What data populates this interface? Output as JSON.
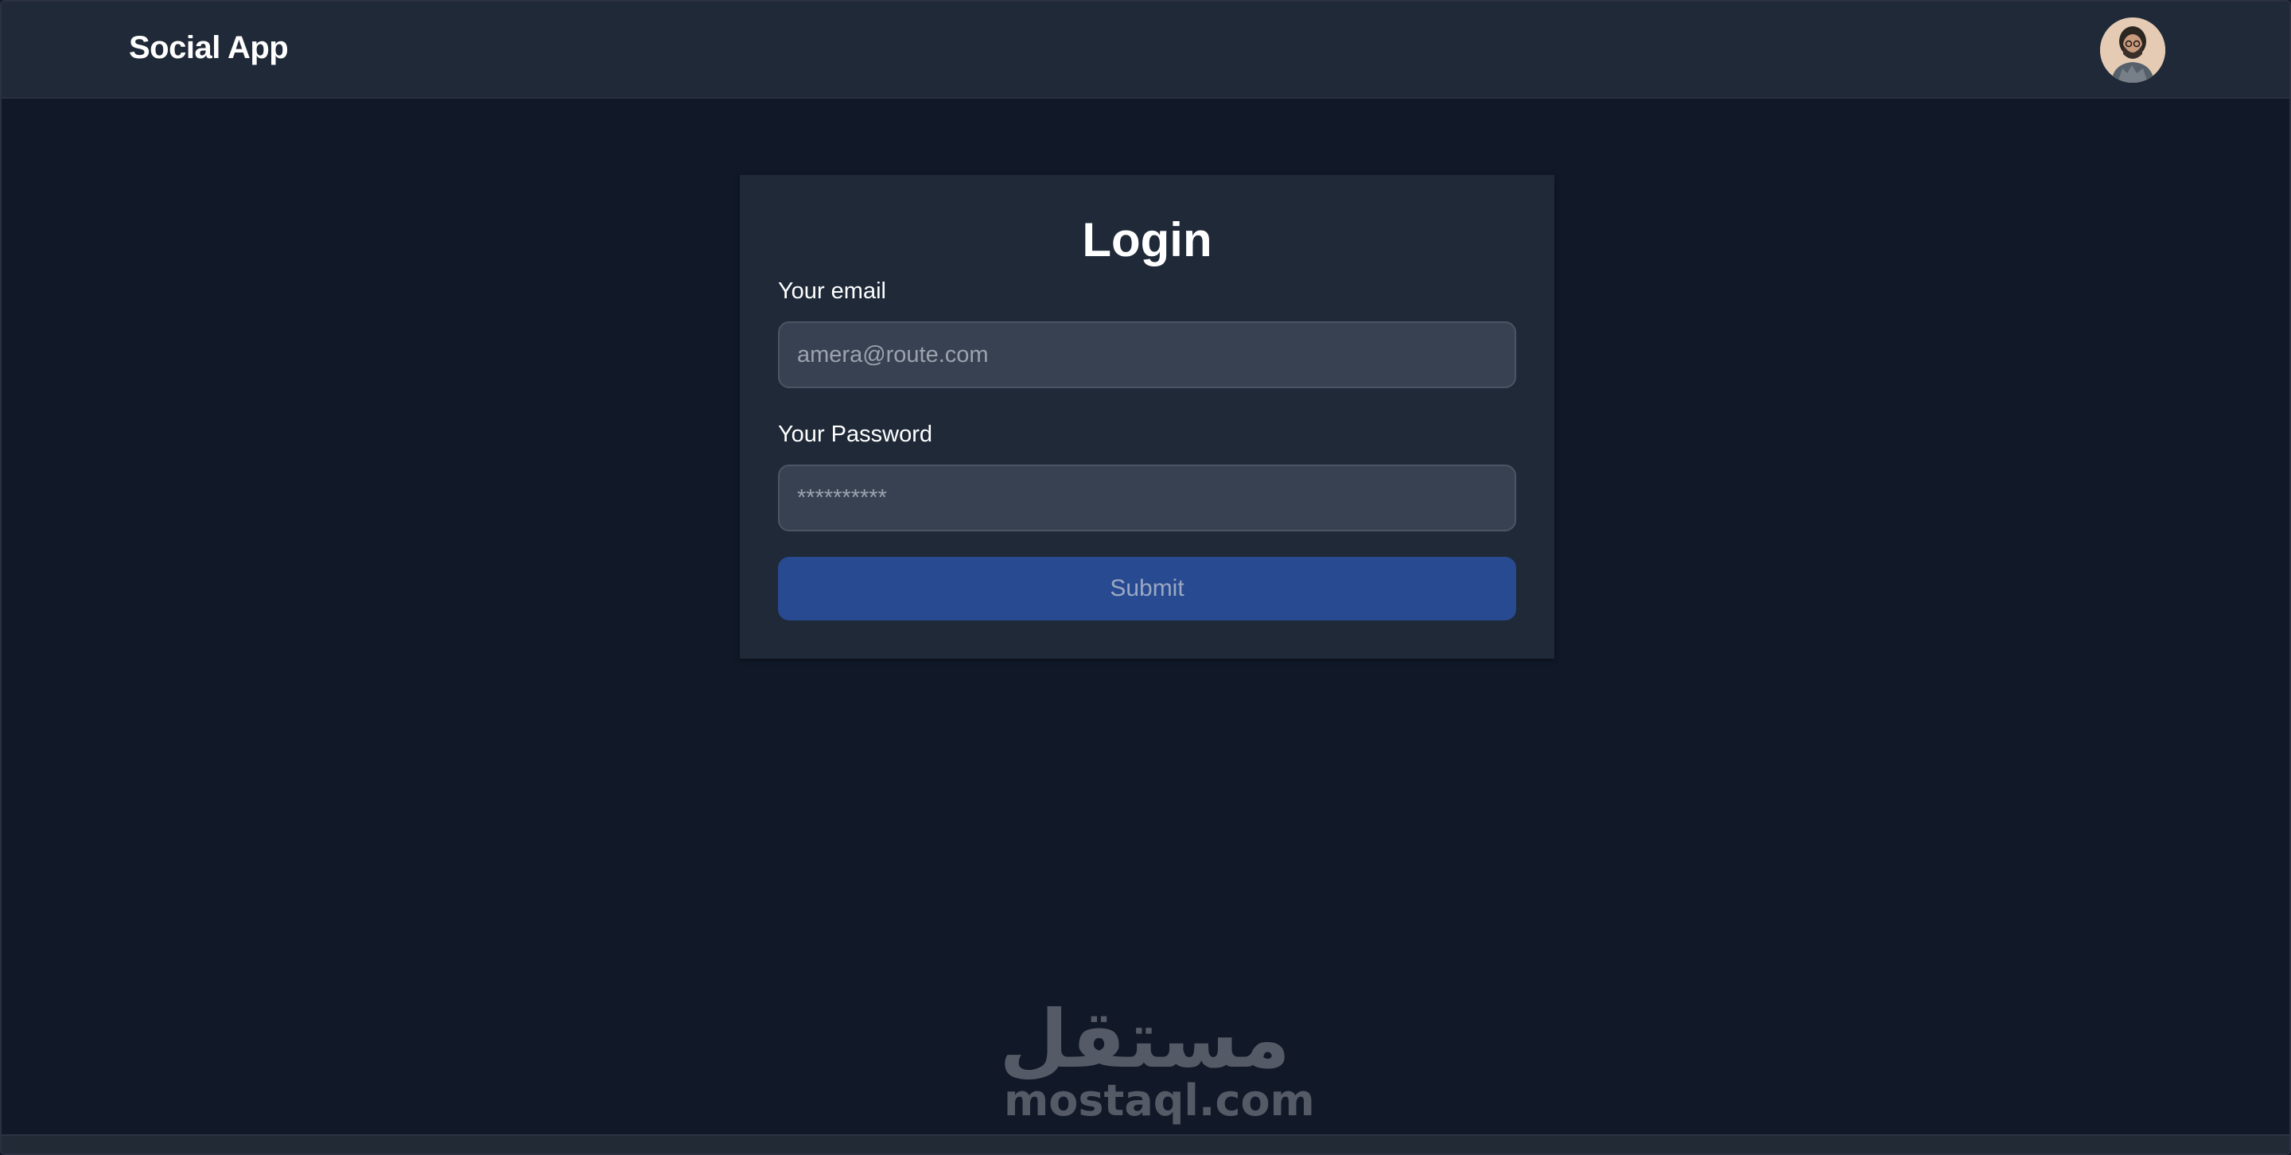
{
  "navbar": {
    "brand": "Social App",
    "avatar_icon": "user-avatar-icon"
  },
  "login": {
    "title": "Login",
    "email_label": "Your email",
    "email_placeholder": "amera@route.com",
    "password_label": "Your Password",
    "password_placeholder": "**********",
    "submit_label": "Submit"
  },
  "watermark": {
    "arabic": "مستقل",
    "latin": "mostaql.com"
  },
  "colors": {
    "page_bg": "#111827",
    "surface": "#1f2937",
    "input_bg": "#374151",
    "button": "#284a91"
  }
}
